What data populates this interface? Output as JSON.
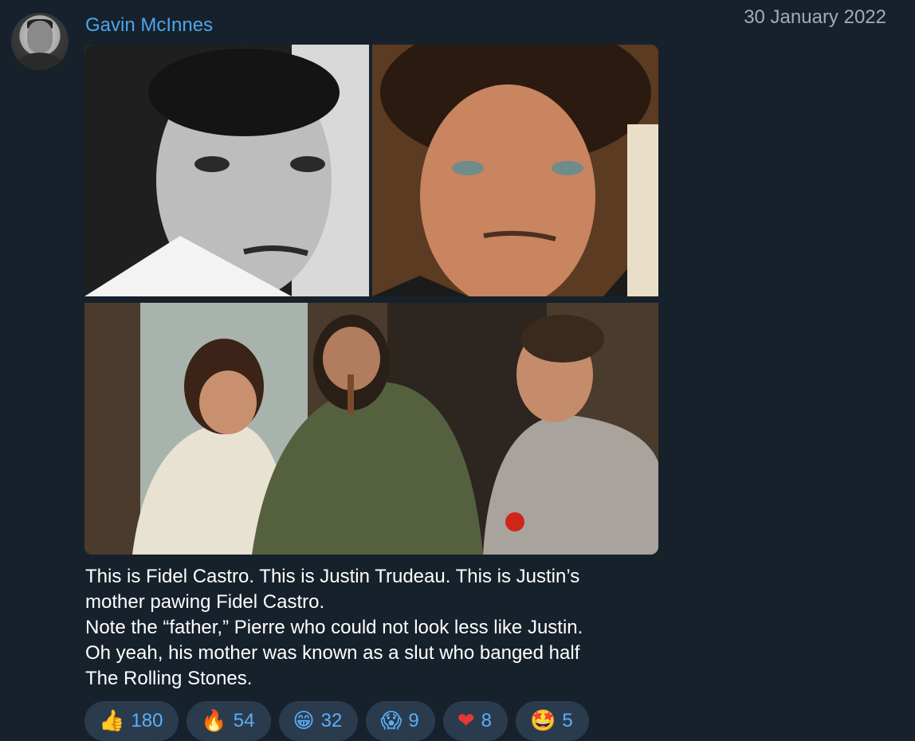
{
  "post": {
    "author": "Gavin McInnes",
    "date": "30 January 2022",
    "caption_lines": [
      "This is Fidel Castro. This is Justin Trudeau. This is Justin’s",
      "mother pawing Fidel Castro.",
      "Note the “father,” Pierre who could not look less like Justin.",
      "Oh yeah, his mother was known as a slut who banged half",
      "The Rolling Stones."
    ]
  },
  "reactions": [
    {
      "icon": "thumbs-up-icon",
      "emoji": "👍",
      "count": "180"
    },
    {
      "icon": "fire-icon",
      "emoji": "🔥",
      "count": "54"
    },
    {
      "icon": "grinning-face-icon",
      "emoji": "😁",
      "count": "32"
    },
    {
      "icon": "screaming-face-icon",
      "emoji": "😱",
      "count": "9"
    },
    {
      "icon": "red-heart-icon",
      "emoji": "❤",
      "count": "8"
    },
    {
      "icon": "star-struck-icon",
      "emoji": "🤩",
      "count": "5"
    }
  ],
  "colors": {
    "background": "#17212b",
    "author": "#4aa6ee",
    "reaction_bg": "#2b3b4e",
    "reaction_text": "#5aaff5"
  }
}
